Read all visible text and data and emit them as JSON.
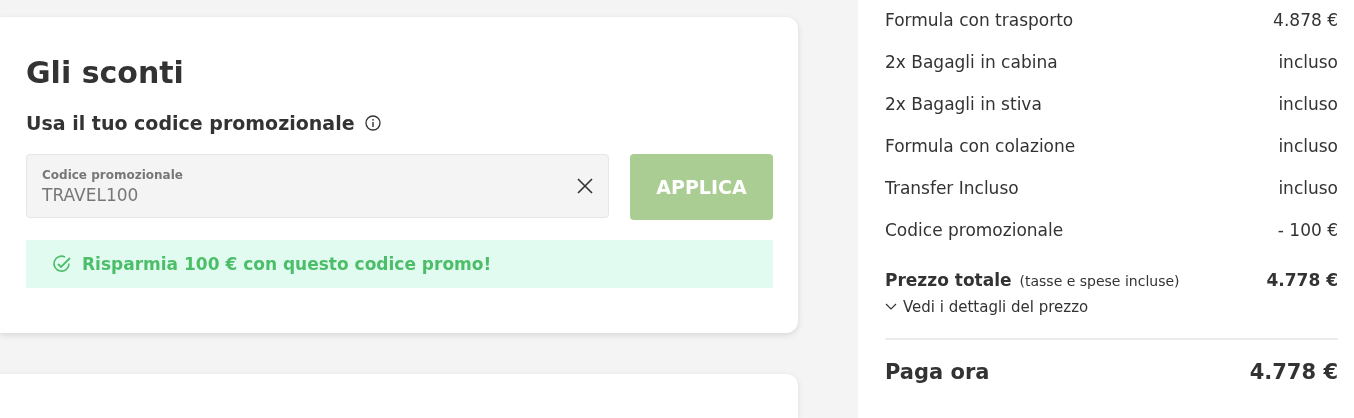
{
  "discounts": {
    "title": "Gli sconti",
    "subtitle": "Usa il tuo codice promozionale",
    "promo_field": {
      "label": "Codice promozionale",
      "value": "TRAVEL100"
    },
    "apply_button": {
      "label": "APPLICA",
      "disabled": true
    },
    "success_message": "Risparmia 100 € con questo codice promo!"
  },
  "summary": {
    "items": [
      {
        "label": "Formula con trasporto",
        "value": "4.878 €"
      },
      {
        "label": "2x Bagagli in cabina",
        "value": "incluso"
      },
      {
        "label": "2x Bagagli in stiva",
        "value": "incluso"
      },
      {
        "label": "Formula con colazione",
        "value": "incluso"
      },
      {
        "label": "Transfer Incluso",
        "value": "incluso"
      },
      {
        "label": "Codice promozionale",
        "value": "- 100 €"
      }
    ],
    "total": {
      "label": "Prezzo totale",
      "note": "(tasse e spese incluse)",
      "value": "4.778 €"
    },
    "details_link": {
      "label": "Vedi i dettagli del prezzo",
      "expanded": false
    },
    "pay_now": {
      "label": "Paga ora",
      "value": "4.778 €"
    }
  }
}
